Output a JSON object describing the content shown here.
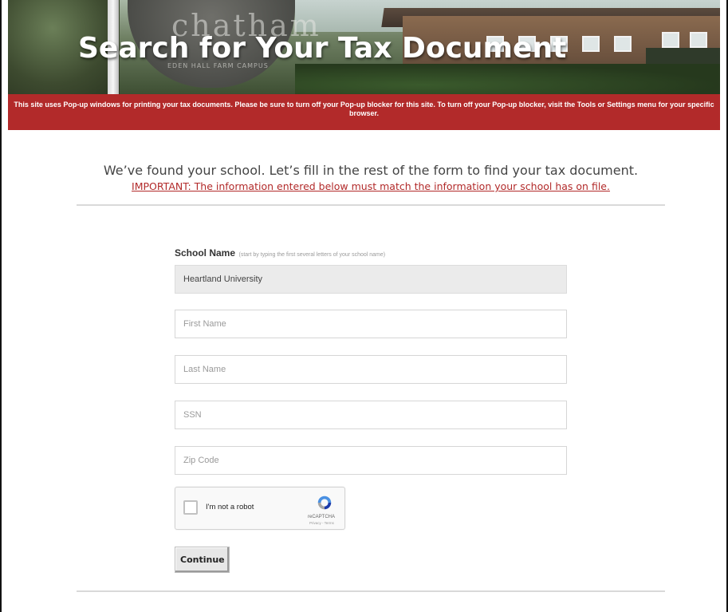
{
  "hero": {
    "title": "Search for Your Tax Document",
    "sign_word": "chatham",
    "sign_subtitle": "EDEN HALL FARM CAMPUS"
  },
  "notice": {
    "text": "This site uses Pop-up windows for printing your tax documents. Please be sure to turn off your Pop-up blocker for this site. To turn off your Pop-up blocker, visit the Tools or Settings menu for your specific browser.",
    "background": "#b22a2a"
  },
  "intro": {
    "lead": "We’ve found your school. Let’s fill in the rest of the form to find your tax document.",
    "important": "IMPORTANT: The information entered below must match the information your school has on file."
  },
  "form": {
    "school_label": "School Name",
    "school_hint": "(start by typing the first several letters of your school name)",
    "school_value": "Heartland University",
    "first_name_placeholder": "First Name",
    "last_name_placeholder": "Last Name",
    "ssn_placeholder": "SSN",
    "zip_placeholder": "Zip Code",
    "continue_label": "Continue"
  },
  "recaptcha": {
    "label": "I'm not a robot",
    "brand": "reCAPTCHA",
    "links": "Privacy - Terms",
    "icon": "recaptcha-logo-icon"
  }
}
